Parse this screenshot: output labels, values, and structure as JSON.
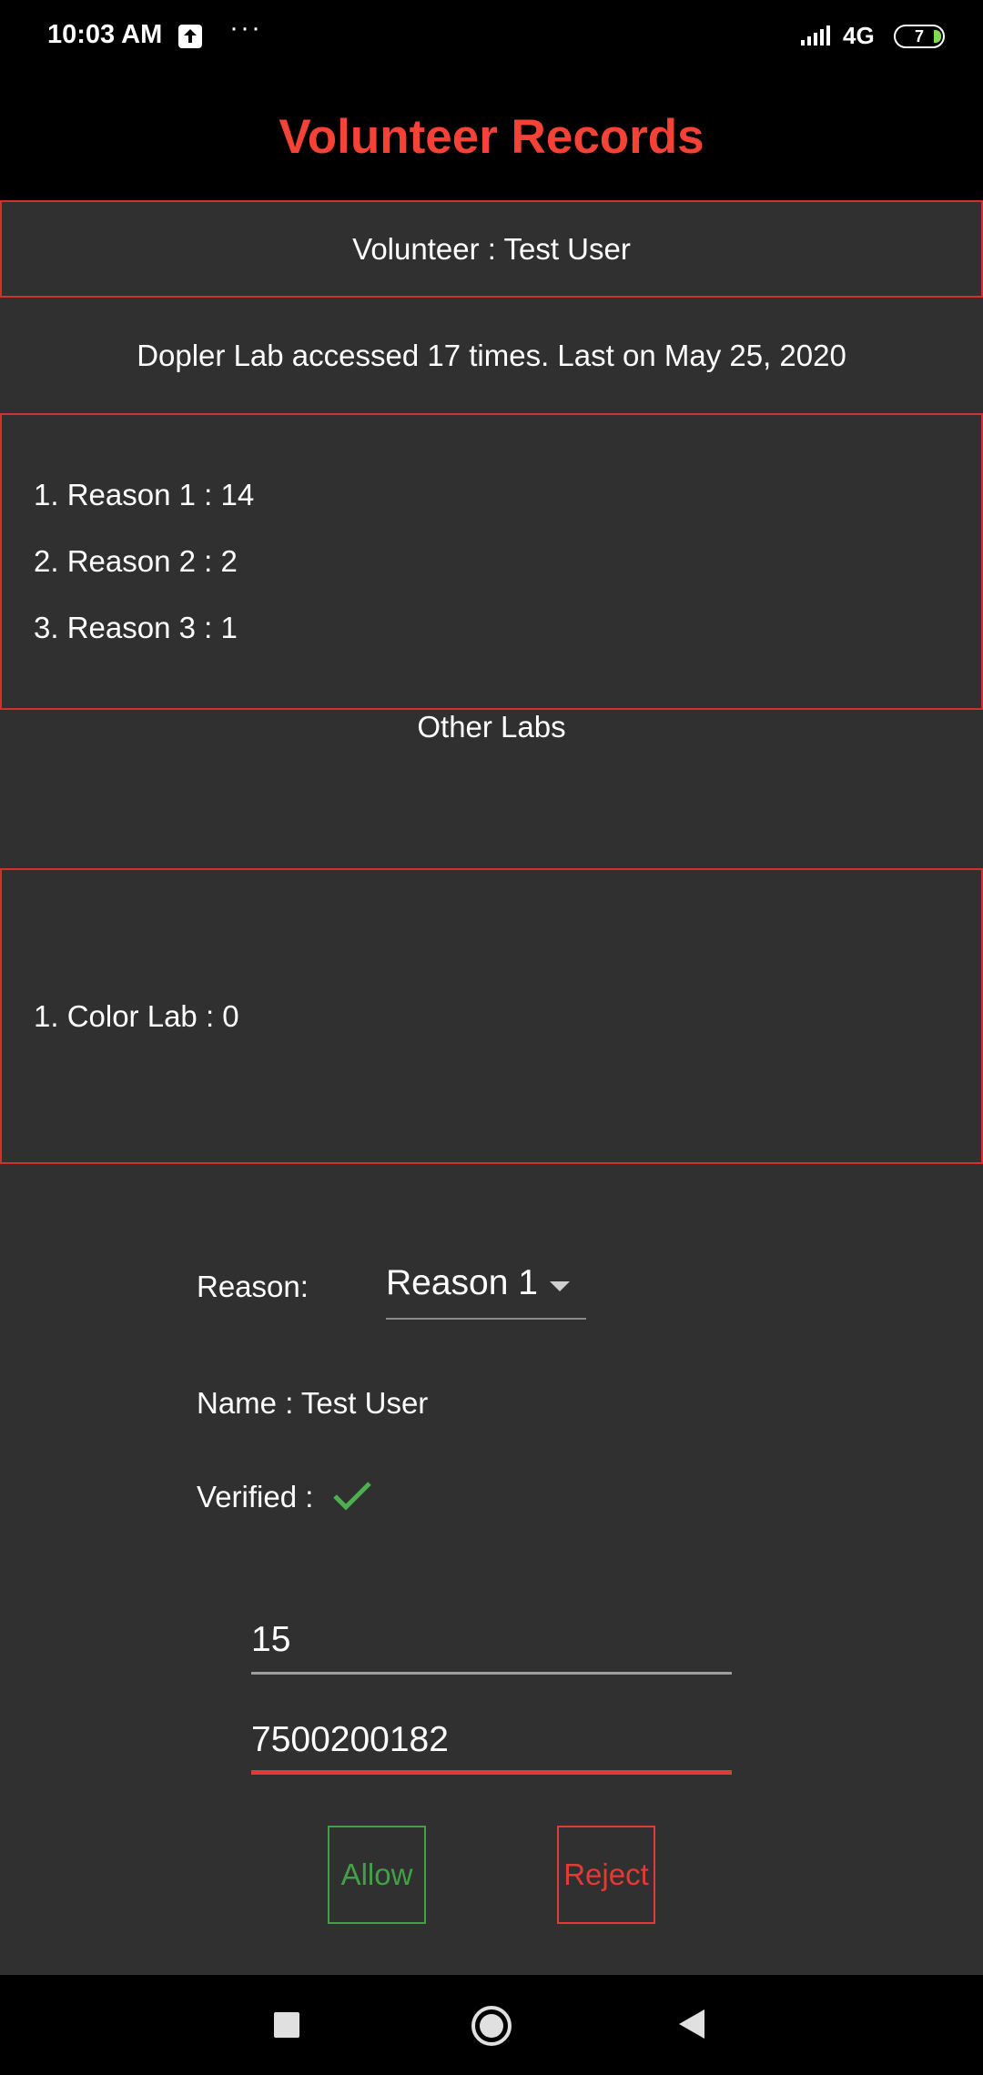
{
  "status_bar": {
    "time": "10:03 AM",
    "more": "···",
    "network": "4G",
    "battery": "7",
    "icons": [
      "upload-icon",
      "signal-icon",
      "battery-icon"
    ]
  },
  "app_bar": {
    "title": "Volunteer Records"
  },
  "volunteer": {
    "text": "Volunteer : Test User"
  },
  "access_summary": "Dopler Lab accessed 17 times. Last on May 25, 2020",
  "reasons": [
    "1. Reason 1 : 14",
    "2. Reason 2 : 2",
    "3. Reason 3 : 1"
  ],
  "other_labs": {
    "title": "Other Labs",
    "items": [
      "1. Color Lab : 0"
    ]
  },
  "form": {
    "reason_label": "Reason:",
    "reason_selected": "Reason 1",
    "name_text": "Name : Test User",
    "verified_label": "Verified :",
    "count_value": "15",
    "phone_value": "7500200182"
  },
  "actions": {
    "allow": "Allow",
    "reject": "Reject"
  },
  "colors": {
    "accent": "#f44336",
    "allow": "#43a047",
    "reject": "#e53935",
    "background": "#303030",
    "bar": "#000000"
  }
}
